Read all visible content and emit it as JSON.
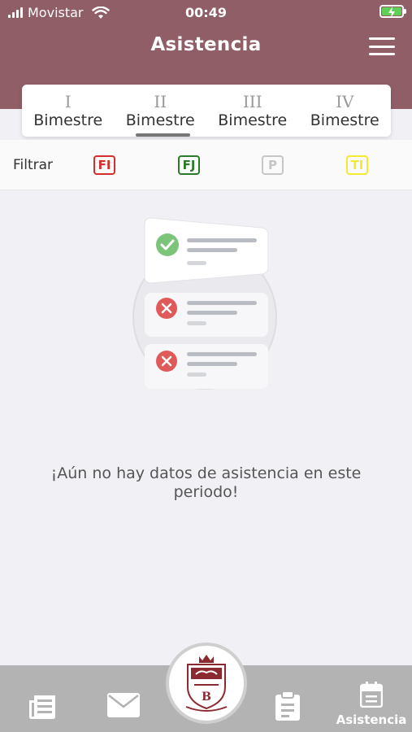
{
  "status_bar": {
    "carrier": "Movistar",
    "time": "00:49"
  },
  "header": {
    "title": "Asistencia"
  },
  "tabs": [
    {
      "roman": "I",
      "label": "Bimestre"
    },
    {
      "roman": "II",
      "label": "Bimestre"
    },
    {
      "roman": "III",
      "label": "Bimestre"
    },
    {
      "roman": "IV",
      "label": "Bimestre"
    }
  ],
  "selected_tab": 1,
  "filter": {
    "label": "Filtrar",
    "chips": [
      {
        "code": "FI",
        "color": "#d62d2d"
      },
      {
        "code": "FJ",
        "color": "#2a7a2a"
      },
      {
        "code": "P",
        "color": "#c6c6c6"
      },
      {
        "code": "TI",
        "color": "#f2ea33"
      }
    ]
  },
  "empty_state": {
    "message": "¡Aún no hay datos de asistencia en este periodo!"
  },
  "bottom_nav": {
    "items": [
      {
        "icon": "news-icon"
      },
      {
        "icon": "mail-icon"
      },
      {
        "icon": "school-logo"
      },
      {
        "icon": "clipboard-icon"
      },
      {
        "icon": "calendar-icon",
        "label": "Asistencia"
      }
    ]
  },
  "colors": {
    "header": "#8f5e67",
    "background": "#f1f1f5",
    "nav": "#b3b3b3"
  }
}
